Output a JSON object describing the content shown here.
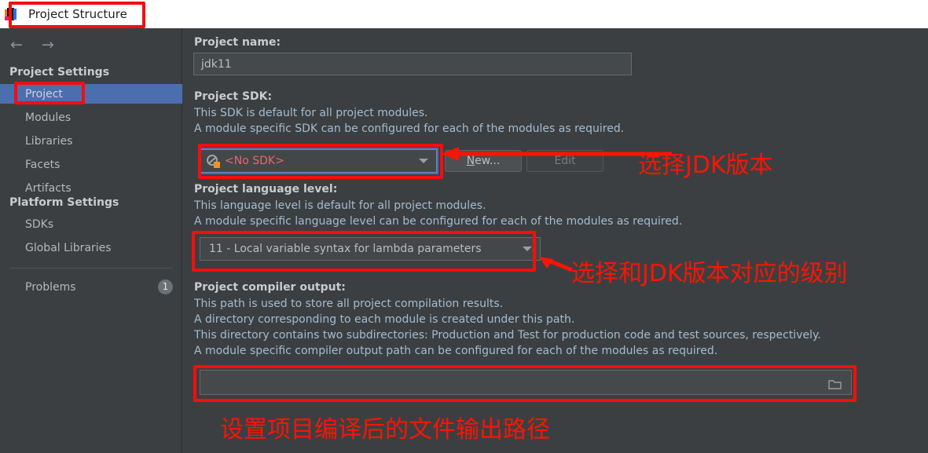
{
  "window": {
    "title": "Project Structure",
    "app_icon": "intellij-idea-icon"
  },
  "nav": {
    "back": "←",
    "forward": "→"
  },
  "sidebar": {
    "groups": [
      {
        "header": "Project Settings",
        "items": [
          {
            "label": "Project",
            "selected": true
          },
          {
            "label": "Modules",
            "selected": false
          },
          {
            "label": "Libraries",
            "selected": false
          },
          {
            "label": "Facets",
            "selected": false
          },
          {
            "label": "Artifacts",
            "selected": false
          }
        ]
      },
      {
        "header": "Platform Settings",
        "items": [
          {
            "label": "SDKs",
            "selected": false
          },
          {
            "label": "Global Libraries",
            "selected": false
          }
        ]
      }
    ],
    "problems": {
      "label": "Problems",
      "count": "1"
    }
  },
  "main": {
    "project_name": {
      "label": "Project name:",
      "value": "jdk11"
    },
    "project_sdk": {
      "label": "Project SDK:",
      "desc_line1": "This SDK is default for all project modules.",
      "desc_line2": "A module specific SDK can be configured for each of the modules as required.",
      "combo_value": "<No SDK>",
      "combo_icon": "sdk-warning-icon",
      "new_button": "New...",
      "new_button_mnemonic": "N",
      "new_button_rest": "ew...",
      "edit_button": "Edit",
      "edit_disabled": true
    },
    "language_level": {
      "label": "Project language level:",
      "desc_line1": "This language level is default for all project modules.",
      "desc_line2": "A module specific language level can be configured for each of the modules as required.",
      "combo_value": "11 - Local variable syntax for lambda parameters"
    },
    "compiler_output": {
      "label": "Project compiler output:",
      "desc_line1": "This path is used to store all project compilation results.",
      "desc_line2": "A directory corresponding to each module is created under this path.",
      "desc_line3": "This directory contains two subdirectories: Production and Test for production code and test sources, respectively.",
      "desc_line4": "A module specific compiler output path can be configured for each of the modules as required.",
      "value": "",
      "browse_icon": "folder-icon"
    }
  },
  "annotations": {
    "color": "#fa1405",
    "jdk_version": "选择JDK版本",
    "language_level": "选择和JDK版本对应的级别",
    "compiler_output": "设置项目编译后的文件输出路径"
  }
}
